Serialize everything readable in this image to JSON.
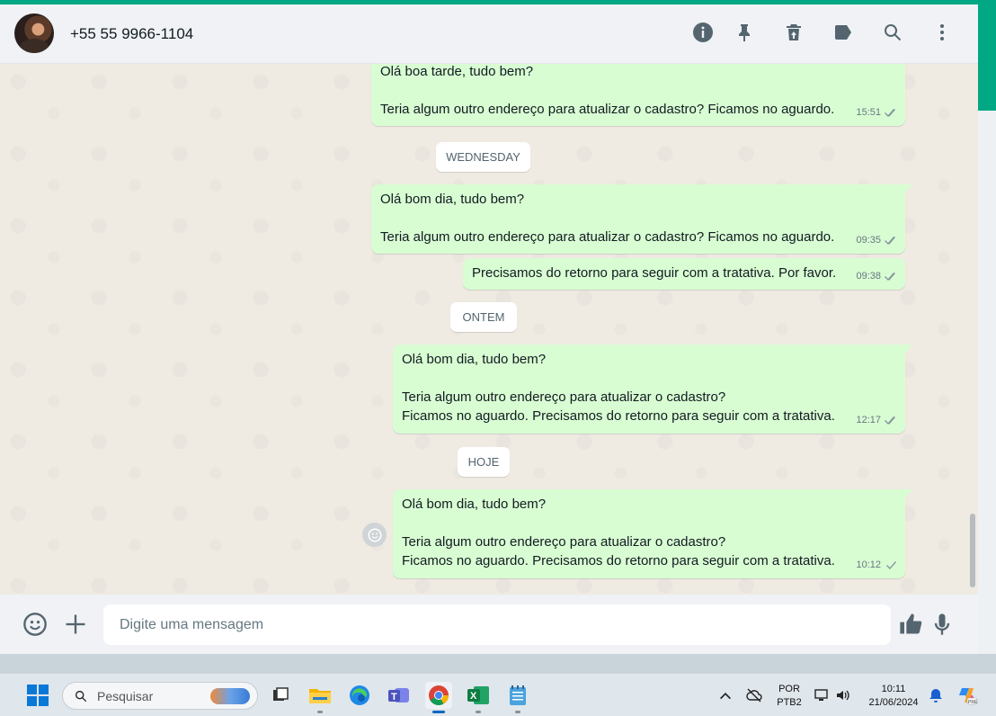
{
  "header": {
    "contact_name": "+55 55 9966-1104",
    "icons": [
      "info-icon",
      "pin-icon",
      "delete-icon",
      "label-icon",
      "search-icon",
      "menu-icon"
    ]
  },
  "messages": [
    {
      "text": "Olá boa tarde, tudo bem?\n\nTeria algum outro endereço para atualizar o cadastro? Ficamos no aguardo.",
      "time": "15:51",
      "status": "read"
    },
    {
      "date_chip": "WEDNESDAY"
    },
    {
      "text": "Olá bom dia, tudo bem?\n\nTeria algum outro endereço para atualizar o cadastro? Ficamos no aguardo.",
      "time": "09:35",
      "status": "read"
    },
    {
      "text": "Precisamos do retorno para seguir com a tratativa. Por favor.",
      "time": "09:38",
      "status": "read"
    },
    {
      "date_chip": "ONTEM"
    },
    {
      "text": "Olá bom dia, tudo bem?\n\nTeria algum outro endereço para atualizar o cadastro?\nFicamos no aguardo. Precisamos do retorno para seguir com a tratativa.",
      "time": "12:17",
      "status": "read"
    },
    {
      "date_chip": "HOJE"
    },
    {
      "text": "Olá bom dia, tudo bem?\n\nTeria algum outro endereço para atualizar o cadastro?\nFicamos no aguardo. Precisamos do retorno para seguir com a tratativa.",
      "time": "10:12",
      "status": "sent"
    }
  ],
  "chips": {
    "wednesday": "WEDNESDAY",
    "ontem": "ONTEM",
    "hoje": "HOJE"
  },
  "bubbles": {
    "m1_time": "15:51",
    "m1_l1": "Olá boa tarde, tudo bem?",
    "m1_l2": "Teria algum outro endereço para atualizar o cadastro? Ficamos no aguardo.",
    "m2_time": "09:35",
    "m2_l1": "Olá bom dia, tudo bem?",
    "m2_l2": "Teria algum outro endereço para atualizar o cadastro? Ficamos no aguardo.",
    "m3_time": "09:38",
    "m3_l1": "Precisamos do retorno para seguir com a tratativa. Por favor.",
    "m4_time": "12:17",
    "m4_l1": "Olá bom dia, tudo bem?",
    "m4_l2": "Teria algum outro endereço para atualizar o cadastro?",
    "m4_l3": "Ficamos no aguardo. Precisamos do retorno para seguir com a tratativa.",
    "m5_time": "10:12",
    "m5_l1": "Olá bom dia, tudo bem?",
    "m5_l2": "Teria algum outro endereço para atualizar o cadastro?",
    "m5_l3": "Ficamos no aguardo. Precisamos do retorno para seguir com a tratativa."
  },
  "composer": {
    "placeholder": "Digite uma mensagem"
  },
  "taskbar": {
    "search_label": "Pesquisar",
    "lang_top": "POR",
    "lang_bottom": "PTB2",
    "time": "10:11",
    "date": "21/06/2024",
    "apps": [
      "task-view",
      "file-explorer",
      "edge",
      "teams",
      "chrome",
      "excel",
      "notepad"
    ]
  },
  "colors": {
    "accent": "#00a884",
    "bubble_out": "#d9fdd3",
    "chat_bg": "#efeae2",
    "header_bg": "#f0f2f5"
  }
}
